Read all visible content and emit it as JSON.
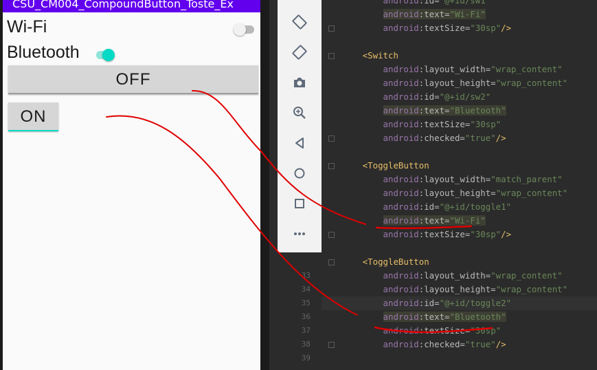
{
  "app": {
    "title": "CSU_CM004_CompoundButton_Toste_Ex"
  },
  "switches": [
    {
      "label": "Wi-Fi",
      "checked": false
    },
    {
      "label": "Bluetooth",
      "checked": true
    }
  ],
  "toggles": [
    {
      "label": "OFF",
      "checked": false
    },
    {
      "label": "ON",
      "checked": true
    }
  ],
  "colors": {
    "app_bar": "#6200ee",
    "accent": "#03dac5",
    "annotation": "#e00000"
  },
  "toolbar": {
    "icons": [
      "rotate-left-icon",
      "rotate-right-icon",
      "camera-icon",
      "zoom-in-icon",
      "back-icon",
      "home-icon",
      "overview-icon",
      "more-icon"
    ]
  },
  "editor": {
    "line_numbers": [
      "33",
      "34",
      "35",
      "36",
      "37",
      "38",
      "39"
    ],
    "lines": [
      {
        "indent": "        ",
        "parts": [
          [
            "ns",
            "android"
          ],
          [
            "attr",
            ":id="
          ],
          [
            "val",
            "\"@+id/sw1\""
          ]
        ]
      },
      {
        "indent": "        ",
        "parts": [
          [
            "ns",
            "android"
          ],
          [
            "attr",
            ":text="
          ],
          [
            "val",
            "\"Wi-Fi\""
          ]
        ]
      },
      {
        "indent": "        ",
        "parts": [
          [
            "ns",
            "android"
          ],
          [
            "attr",
            ":textSize="
          ],
          [
            "val",
            "\"30sp\""
          ],
          [
            "tag",
            "/>"
          ]
        ]
      },
      {
        "indent": "",
        "parts": []
      },
      {
        "indent": "    ",
        "parts": [
          [
            "tag",
            "<Switch"
          ]
        ]
      },
      {
        "indent": "        ",
        "parts": [
          [
            "ns",
            "android"
          ],
          [
            "attr",
            ":layout_width="
          ],
          [
            "val",
            "\"wrap_content\""
          ]
        ]
      },
      {
        "indent": "        ",
        "parts": [
          [
            "ns",
            "android"
          ],
          [
            "attr",
            ":layout_height="
          ],
          [
            "val",
            "\"wrap_content\""
          ]
        ]
      },
      {
        "indent": "        ",
        "parts": [
          [
            "ns",
            "android"
          ],
          [
            "attr",
            ":id="
          ],
          [
            "val",
            "\"@+id/sw2\""
          ]
        ]
      },
      {
        "indent": "        ",
        "parts": [
          [
            "ns",
            "android"
          ],
          [
            "attr",
            ":text="
          ],
          [
            "val",
            "\"Bluetooth\""
          ]
        ]
      },
      {
        "indent": "        ",
        "parts": [
          [
            "ns",
            "android"
          ],
          [
            "attr",
            ":textSize="
          ],
          [
            "val",
            "\"30sp\""
          ]
        ]
      },
      {
        "indent": "        ",
        "parts": [
          [
            "ns",
            "android"
          ],
          [
            "attr",
            ":checked="
          ],
          [
            "val",
            "\"true\""
          ],
          [
            "tag",
            "/>"
          ]
        ]
      },
      {
        "indent": "",
        "parts": []
      },
      {
        "indent": "    ",
        "parts": [
          [
            "tag",
            "<ToggleButton"
          ]
        ]
      },
      {
        "indent": "        ",
        "parts": [
          [
            "ns",
            "android"
          ],
          [
            "attr",
            ":layout_width="
          ],
          [
            "val",
            "\"match_parent\""
          ]
        ]
      },
      {
        "indent": "        ",
        "parts": [
          [
            "ns",
            "android"
          ],
          [
            "attr",
            ":layout_height="
          ],
          [
            "val",
            "\"wrap_content\""
          ]
        ]
      },
      {
        "indent": "        ",
        "parts": [
          [
            "ns",
            "android"
          ],
          [
            "attr",
            ":id="
          ],
          [
            "val",
            "\"@+id/toggle1\""
          ]
        ]
      },
      {
        "indent": "        ",
        "parts": [
          [
            "ns",
            "android"
          ],
          [
            "attr",
            ":text="
          ],
          [
            "val",
            "\"Wi-Fi\""
          ]
        ]
      },
      {
        "indent": "        ",
        "parts": [
          [
            "ns",
            "android"
          ],
          [
            "attr",
            ":textSize="
          ],
          [
            "val",
            "\"30sp\""
          ],
          [
            "tag",
            "/>"
          ]
        ]
      },
      {
        "indent": "",
        "parts": []
      },
      {
        "indent": "    ",
        "parts": [
          [
            "tag",
            "<ToggleButton"
          ]
        ]
      },
      {
        "indent": "        ",
        "parts": [
          [
            "ns",
            "android"
          ],
          [
            "attr",
            ":layout_width="
          ],
          [
            "val",
            "\"wrap_content\""
          ]
        ]
      },
      {
        "indent": "        ",
        "parts": [
          [
            "ns",
            "android"
          ],
          [
            "attr",
            ":layout_height="
          ],
          [
            "val",
            "\"wrap_content\""
          ]
        ]
      },
      {
        "indent": "        ",
        "parts": [
          [
            "ns",
            "android"
          ],
          [
            "attr",
            ":id="
          ],
          [
            "val",
            "\"@+id/toggle2\""
          ]
        ]
      },
      {
        "indent": "        ",
        "parts": [
          [
            "ns",
            "android"
          ],
          [
            "attr",
            ":text="
          ],
          [
            "val",
            "\"Bluetooth\""
          ]
        ]
      },
      {
        "indent": "        ",
        "parts": [
          [
            "ns",
            "android"
          ],
          [
            "attr",
            ":textSize="
          ],
          [
            "val",
            "\"30sp\""
          ]
        ]
      },
      {
        "indent": "        ",
        "parts": [
          [
            "ns",
            "android"
          ],
          [
            "attr",
            ":checked="
          ],
          [
            "val",
            "\"true\""
          ],
          [
            "tag",
            "/>"
          ]
        ]
      },
      {
        "indent": "",
        "parts": []
      }
    ]
  }
}
